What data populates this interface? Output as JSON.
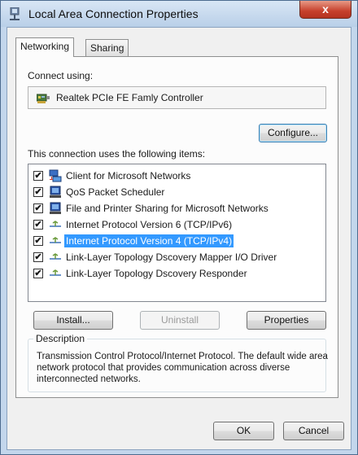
{
  "window": {
    "title": "Local Area Connection Properties",
    "close_symbol": "x",
    "icon": "network-adapter-icon"
  },
  "tabs": [
    {
      "label": "Networking",
      "active": true
    },
    {
      "label": "Sharing",
      "active": false
    }
  ],
  "connect_using_label": "Connect using:",
  "adapter": {
    "name": "Realtek PCIe FE Famly Controller",
    "icon": "network-card-icon"
  },
  "configure_button": "Configure...",
  "items_label": "This connection uses the following items:",
  "items": [
    {
      "label": "Client for Microsoft Networks",
      "checked": true,
      "icon": "network-client-icon"
    },
    {
      "label": "QoS Packet Scheduler",
      "checked": true,
      "icon": "scheduler-icon"
    },
    {
      "label": "File and Printer Sharing for Microsoft Networks",
      "checked": true,
      "icon": "file-printer-sharing-icon"
    },
    {
      "label": "Internet Protocol Version 6 (TCP/IPv6)",
      "checked": true,
      "icon": "protocol-icon"
    },
    {
      "label": "Internet Protocol Version 4 (TCP/IPv4)",
      "checked": true,
      "icon": "protocol-icon",
      "selected": true
    },
    {
      "label": "Link-Layer Topology Dscovery Mapper I/O Driver",
      "checked": true,
      "icon": "protocol-icon"
    },
    {
      "label": "Link-Layer Topology Dscovery Responder",
      "checked": true,
      "icon": "protocol-icon"
    }
  ],
  "buttons": {
    "install": "Install...",
    "uninstall": "Uninstall",
    "properties": "Properties",
    "ok": "OK",
    "cancel": "Cancel"
  },
  "description": {
    "legend": "Description",
    "text": "Transmission Control Protocol/Internet Protocol. The default wide area network protocol that provides communication across diverse interconnected networks."
  },
  "colors": {
    "selection": "#3399ff",
    "close_button": "#c6402c",
    "title_bar": "#c3d6ec"
  }
}
